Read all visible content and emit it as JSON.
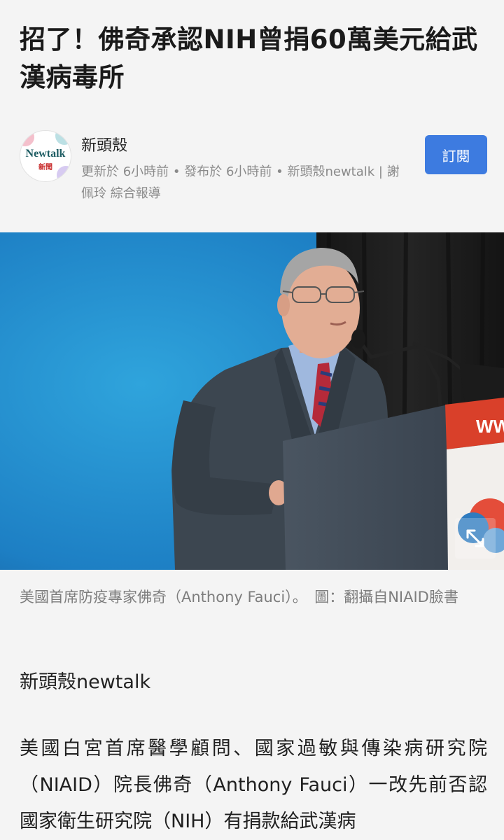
{
  "article": {
    "headline": "招了！佛奇承認NIH曾捐60萬美元給武漢病毒所",
    "byline_text": "新頭殼newtalk",
    "paragraph": "美國白宮首席醫學顧問、國家過敏與傳染病研究院（NIAID）院長佛奇（Anthony Fauci）一改先前否認國家衛生研究院（NIH）有捐款給武漢病"
  },
  "publisher": {
    "logo_text": "Newtalk",
    "logo_sub": "新聞",
    "name": "新頭殼",
    "meta": "更新於 6小時前 • 發布於 6小時前 • 新頭殼newtalk | 謝佩玲 綜合報導",
    "subscribe_label": "訂閱"
  },
  "image": {
    "caption": "美國首席防疫專家佛奇（Anthony Fauci）。　圖：翻攝自NIAID臉書",
    "podium_text": "WWW"
  },
  "icons": {
    "expand": "expand-icon"
  },
  "colors": {
    "subscribe": "#3d7be0",
    "photo_background": "#1f86c8"
  }
}
